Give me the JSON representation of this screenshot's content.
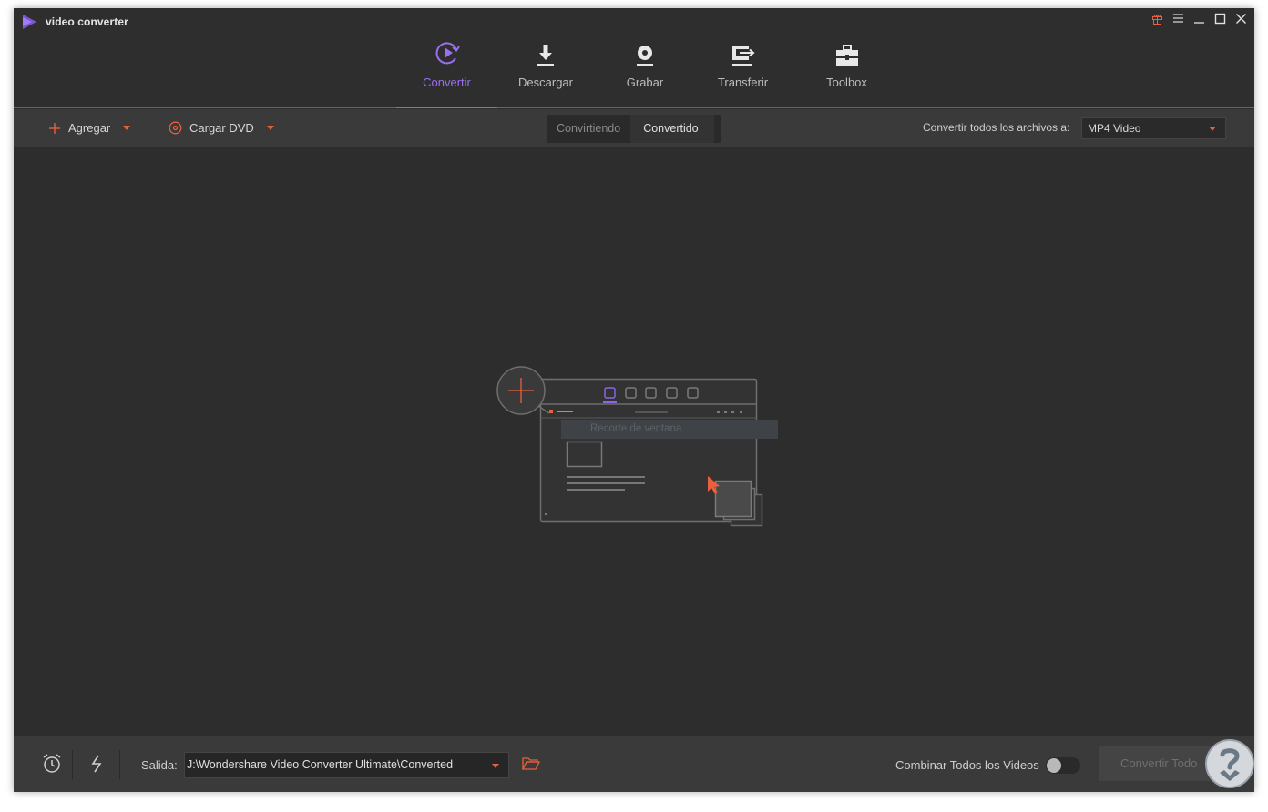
{
  "app": {
    "title": "video converter",
    "logo_icon": "play-triangle-logo",
    "accent": "#8e63e8",
    "highlight": "#e8603c"
  },
  "window_controls": {
    "gift_icon": "gift-icon",
    "menu_icon": "hamburger-icon",
    "minimize_icon": "minimize-icon",
    "maximize_icon": "maximize-icon",
    "close_icon": "close-icon"
  },
  "nav": {
    "items": [
      {
        "label": "Convertir",
        "icon": "convert-icon",
        "active": true
      },
      {
        "label": "Descargar",
        "icon": "download-icon",
        "active": false
      },
      {
        "label": "Grabar",
        "icon": "disc-icon",
        "active": false
      },
      {
        "label": "Transferir",
        "icon": "transfer-icon",
        "active": false
      },
      {
        "label": "Toolbox",
        "icon": "toolbox-icon",
        "active": false
      }
    ]
  },
  "toolbar": {
    "add_label": "Agregar",
    "dvd_label": "Cargar DVD",
    "tabs": [
      "Convirtiendo",
      "Convertido"
    ],
    "active_tab": "Convertido",
    "convert_all_label": "Convertir todos los archivos a:",
    "format_value": "MP4 Video"
  },
  "main": {
    "hint_text": "Recorte de ventana"
  },
  "bottom": {
    "output_label": "Salida:",
    "output_path": "J:\\Wondershare Video Converter Ultimate\\Converted",
    "combine_label": "Combinar Todos los Videos",
    "combine_enabled": false,
    "convert_all_button": "Convertir Todo"
  }
}
